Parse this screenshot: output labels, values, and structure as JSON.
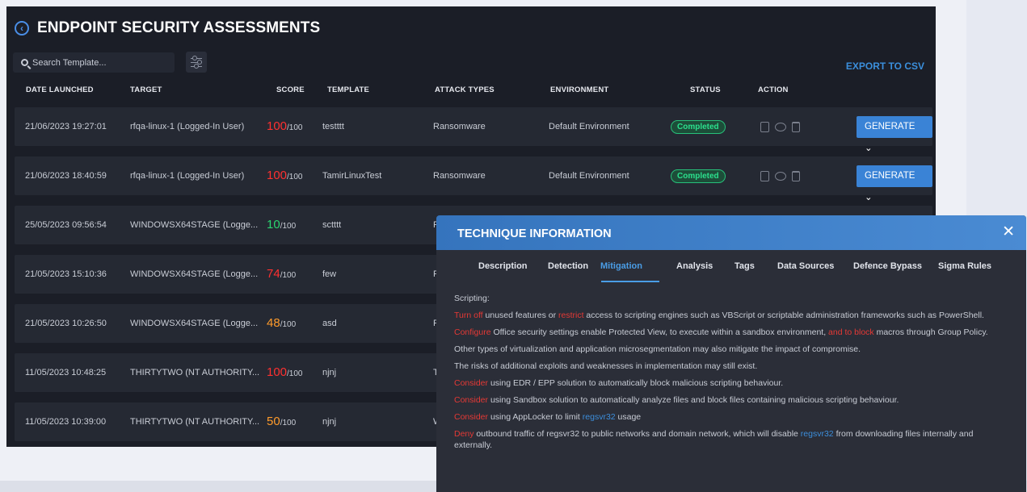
{
  "page": {
    "title": "ENDPOINT SECURITY ASSESSMENTS",
    "search_placeholder": "Search Template...",
    "export_label": "EXPORT TO CSV"
  },
  "table": {
    "headers": [
      "DATE LAUNCHED",
      "TARGET",
      "SCORE",
      "TEMPLATE",
      "ATTACK TYPES",
      "ENVIRONMENT",
      "STATUS",
      "ACTION"
    ],
    "rows": [
      {
        "date": "21/06/2023 19:27:01",
        "target": "rfqa-linux-1 (Logged-In User)",
        "score": "100",
        "score_max": "/100",
        "score_color": "#ff3030",
        "template": "testttt",
        "attack": "Ransomware",
        "env": "Default Environment",
        "status": "Completed",
        "action": "GENERATE ⌄"
      },
      {
        "date": "21/06/2023 18:40:59",
        "target": "rfqa-linux-1 (Logged-In User)",
        "score": "100",
        "score_max": "/100",
        "score_color": "#ff3030",
        "template": "TamirLinuxTest",
        "attack": "Ransomware",
        "env": "Default Environment",
        "status": "Completed",
        "action": "GENERATE ⌄"
      },
      {
        "date": "25/05/2023 09:56:54",
        "target": "WINDOWSX64STAGE (Logge...",
        "score": "10",
        "score_max": "/100",
        "score_color": "#2bd670",
        "template": "sctttt",
        "attack": "R",
        "env": "",
        "status": "",
        "action": ""
      },
      {
        "date": "21/05/2023 15:10:36",
        "target": "WINDOWSX64STAGE (Logge...",
        "score": "74",
        "score_max": "/100",
        "score_color": "#ff3030",
        "template": "few",
        "attack": "R",
        "env": "",
        "status": "",
        "action": ""
      },
      {
        "date": "21/05/2023 10:26:50",
        "target": "WINDOWSX64STAGE (Logge...",
        "score": "48",
        "score_max": "/100",
        "score_color": "#ff9b2b",
        "template": "asd",
        "attack": "R",
        "env": "",
        "status": "",
        "action": ""
      },
      {
        "date": "11/05/2023 10:48:25",
        "target": "THIRTYTWO (NT AUTHORITY...",
        "score": "100",
        "score_max": "/100",
        "score_color": "#ff3030",
        "template": "njnj",
        "attack": "T",
        "env": "",
        "status": "",
        "action": ""
      },
      {
        "date": "11/05/2023 10:39:00",
        "target": "THIRTYTWO (NT AUTHORITY...",
        "score": "50",
        "score_max": "/100",
        "score_color": "#ff9b2b",
        "template": "njnj",
        "attack": "W",
        "env": "",
        "status": "",
        "action": ""
      }
    ]
  },
  "modal": {
    "title": "TECHNIQUE INFORMATION",
    "tabs": [
      "Description",
      "Detection",
      "Mitigation",
      "Analysis",
      "Tags",
      "Data Sources",
      "Defence Bypass",
      "Sigma Rules"
    ],
    "active_tab": "Mitigation",
    "heading": "Scripting:",
    "paragraphs": [
      [
        {
          "t": "Turn off",
          "c": "red"
        },
        {
          "t": " unused features or "
        },
        {
          "t": "restrict",
          "c": "red"
        },
        {
          "t": " access to scripting engines such as VBScript or scriptable administration frameworks such as PowerShell."
        }
      ],
      [
        {
          "t": "Configure",
          "c": "red"
        },
        {
          "t": " Office security settings enable Protected View, to execute within a sandbox environment, "
        },
        {
          "t": "and to block",
          "c": "red"
        },
        {
          "t": " macros through Group Policy."
        }
      ],
      [
        {
          "t": "Other types of virtualization and application microsegmentation may also mitigate the impact of compromise."
        }
      ],
      [
        {
          "t": "The risks of additional exploits and weaknesses in implementation may still exist."
        }
      ],
      [
        {
          "t": "Consider",
          "c": "red"
        },
        {
          "t": " using EDR / EPP solution to automatically block malicious scripting behaviour."
        }
      ],
      [
        {
          "t": "Consider",
          "c": "red"
        },
        {
          "t": " using Sandbox solution to automatically analyze files and block files containing malicious scripting behaviour."
        }
      ],
      [
        {
          "t": "Consider",
          "c": "red"
        },
        {
          "t": " using AppLocker to limit "
        },
        {
          "t": "regsvr32",
          "c": "blue"
        },
        {
          "t": " usage"
        }
      ],
      [
        {
          "t": "Deny",
          "c": "red"
        },
        {
          "t": " outbound traffic of regsvr32 to public networks and domain network, which will disable "
        },
        {
          "t": "regsvr32",
          "c": "blue"
        },
        {
          "t": " from downloading files internally and externally."
        }
      ]
    ]
  }
}
